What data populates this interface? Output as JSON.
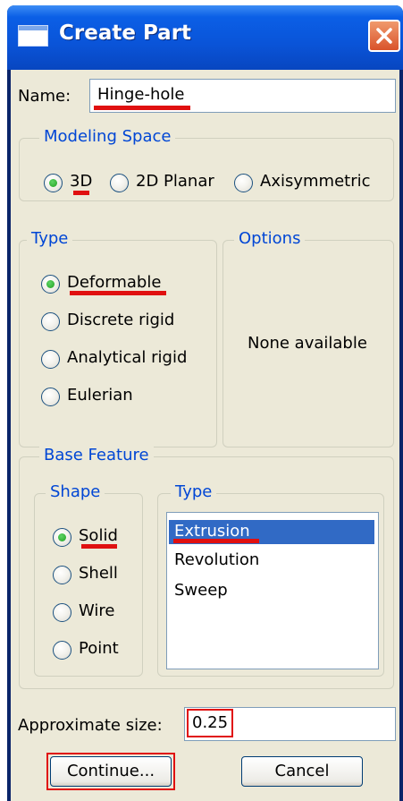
{
  "window": {
    "title": "Create Part"
  },
  "name_field": {
    "label": "Name:",
    "value": "Hinge-hole"
  },
  "modeling_space": {
    "title": "Modeling Space",
    "options": [
      "3D",
      "2D Planar",
      "Axisymmetric"
    ],
    "selected": "3D"
  },
  "type": {
    "title": "Type",
    "options": [
      "Deformable",
      "Discrete rigid",
      "Analytical rigid",
      "Eulerian"
    ],
    "selected": "Deformable"
  },
  "options": {
    "title": "Options",
    "message": "None available"
  },
  "base_feature": {
    "title": "Base Feature",
    "shape": {
      "title": "Shape",
      "options": [
        "Solid",
        "Shell",
        "Wire",
        "Point"
      ],
      "selected": "Solid"
    },
    "type": {
      "title": "Type",
      "items": [
        "Extrusion",
        "Revolution",
        "Sweep"
      ],
      "selected": "Extrusion"
    }
  },
  "approx_size": {
    "label": "Approximate size:",
    "value": "0.25"
  },
  "buttons": {
    "continue": "Continue...",
    "cancel": "Cancel"
  },
  "colors": {
    "title_bar": "#0a54d8",
    "dialog_bg": "#ece9d8",
    "group_title": "#0046d5",
    "list_selection": "#316ac5",
    "annotation": "#e01010"
  },
  "icons": {
    "window": "window-icon",
    "close": "close-icon"
  }
}
